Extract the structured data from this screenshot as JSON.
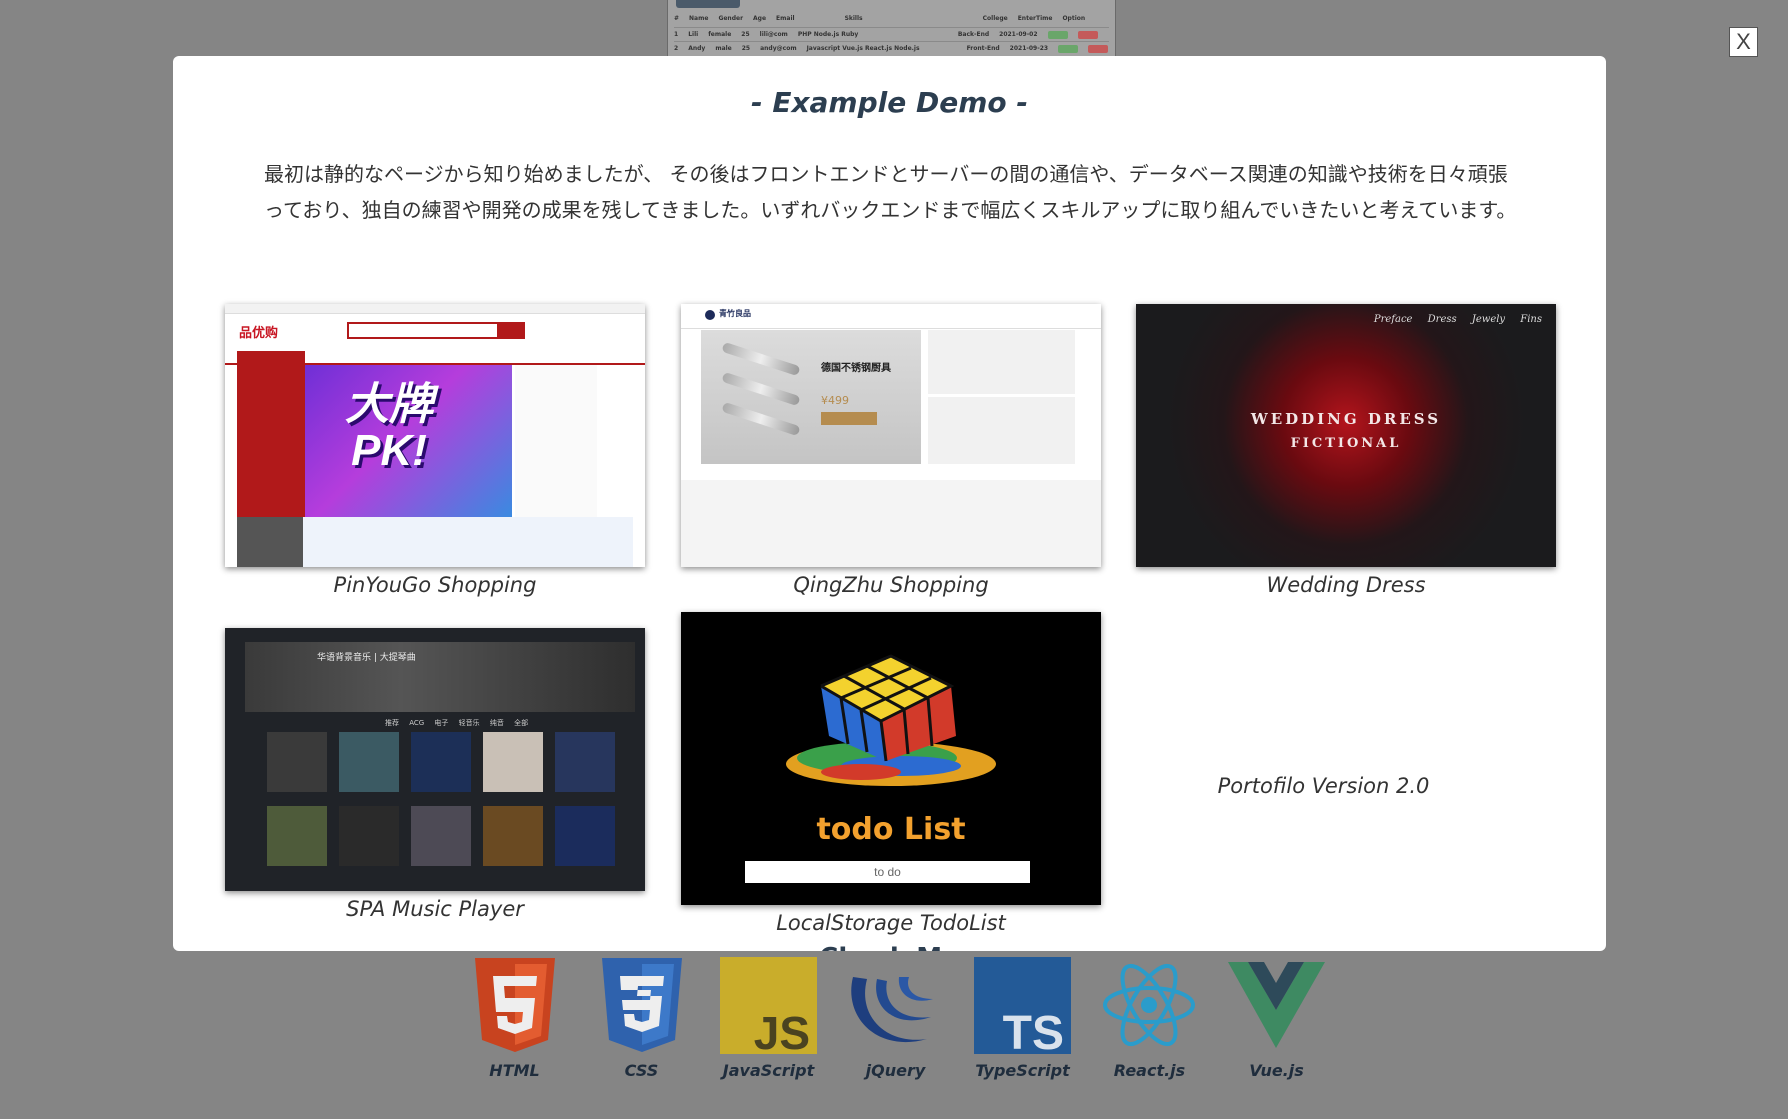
{
  "modal": {
    "title": "- Example Demo -",
    "description": "最初は静的なページから知り始めましたが、 その後はフロントエンドとサーバーの間の通信や、データベース関連の知識や技術を日々頑張っており、独自の練習や開発の成果を残してきました。いずれバックエンドまで幅広くスキルアップに取り組んでいきたいと考えています。",
    "demos": [
      {
        "caption": "PinYouGo Shopping",
        "thumb_text": [
          "品优购",
          "大牌",
          "PK!"
        ]
      },
      {
        "caption": "QingZhu Shopping",
        "thumb_text": [
          "青竹良品",
          "德国不锈钢厨具",
          "¥499"
        ]
      },
      {
        "caption": "Wedding Dress",
        "thumb_text": [
          "Preface",
          "Dress",
          "Jewely",
          "Fins",
          "WEDDING DRESS",
          "FICTIONAL"
        ]
      },
      {
        "caption": "SPA Music Player",
        "thumb_text": [
          "华语背景音乐 | 大提琴曲",
          "推荐 ACG 电子 轻音乐 纯音 全部"
        ]
      },
      {
        "caption": "LocalStorage TodoList",
        "thumb_text": [
          "todo List",
          "to do"
        ]
      }
    ],
    "version_label": "Portofilo Version 2.0",
    "cut_off_heading": "Check Me"
  },
  "close_button": {
    "label": "X"
  },
  "background": {
    "table_headers": [
      "#",
      "Name",
      "Gender",
      "Age",
      "Email",
      "Skills",
      "College",
      "EnterTime",
      "Option"
    ],
    "table_rows": [
      [
        "1",
        "Lili",
        "female",
        "25",
        "lili@com",
        "PHP Node.js Ruby",
        "Back-End",
        "2021-09-02"
      ],
      [
        "2",
        "Andy",
        "male",
        "25",
        "andy@com",
        "Javascript Vue.js React.js Node.js",
        "Front-End",
        "2021-09-23"
      ]
    ],
    "tech": [
      {
        "name": "HTML",
        "color": "#e34f26",
        "glyph": "5"
      },
      {
        "name": "CSS",
        "color": "#1572b6",
        "glyph": "3"
      },
      {
        "name": "JavaScript",
        "color": "#d4b82e",
        "glyph": "JS"
      },
      {
        "name": "jQuery",
        "color": "#1e3e7e",
        "glyph": ""
      },
      {
        "name": "TypeScript",
        "color": "#235a97",
        "glyph": "TS"
      },
      {
        "name": "React.js",
        "color": "#2aa4cf",
        "glyph": ""
      },
      {
        "name": "Vue.js",
        "color": "#3f6f55",
        "glyph": ""
      }
    ]
  }
}
